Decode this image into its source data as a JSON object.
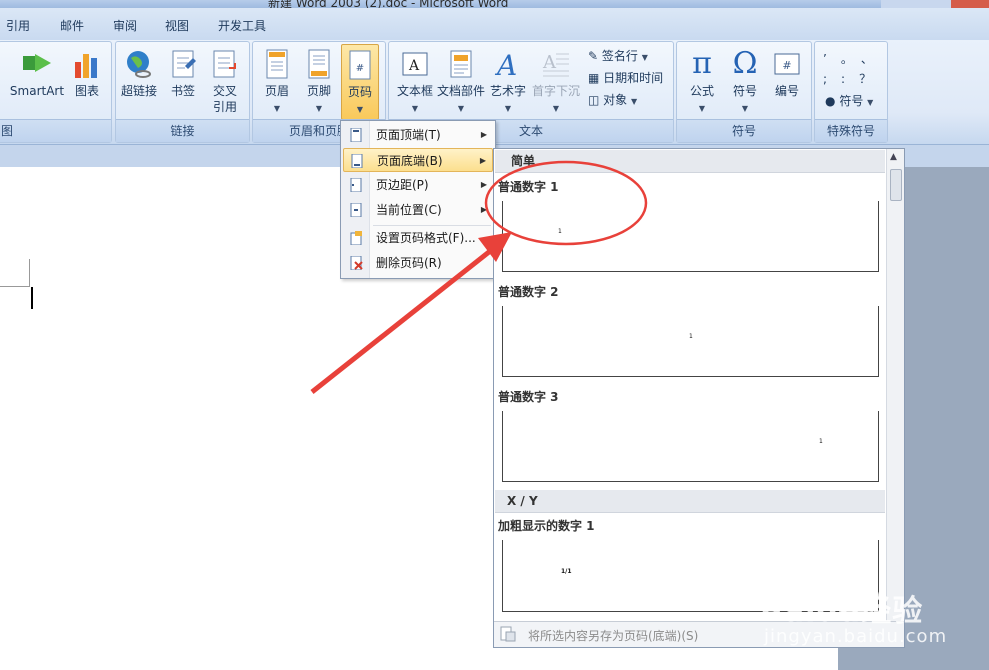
{
  "window": {
    "title_fragment": "新建 Word 2003 (2).doc - Microsoft Word"
  },
  "tabs": [
    "引用",
    "邮件",
    "审阅",
    "视图",
    "开发工具"
  ],
  "ribbon": {
    "illustrations": {
      "smartart": "SmartArt",
      "chart": "图表",
      "group_label": "图"
    },
    "links": {
      "hyperlink": "超链接",
      "bookmark": "书签",
      "crossref_line1": "交叉",
      "crossref_line2": "引用",
      "group_label": "链接"
    },
    "header_footer": {
      "header": "页眉",
      "footer": "页脚",
      "page_number": "页码",
      "group_label": "页眉和页脚"
    },
    "text": {
      "textbox": "文本框",
      "quickparts": "文档部件",
      "wordart": "艺术字",
      "dropcap": "首字下沉",
      "signature": "签名行",
      "datetime": "日期和时间",
      "object": "对象",
      "group_label": "文本"
    },
    "symbols": {
      "equation": "公式",
      "symbol": "符号",
      "number": "编号",
      "group_label": "符号"
    },
    "special": {
      "symbol": "符号",
      "group_label": "特殊符号",
      "chars": [
        "’",
        "。",
        "、",
        ";",
        ":",
        "？"
      ]
    }
  },
  "menu": {
    "items": [
      {
        "label": "页面顶端(T)",
        "has_sub": true
      },
      {
        "label": "页面底端(B)",
        "has_sub": true
      },
      {
        "label": "页边距(P)",
        "has_sub": true
      },
      {
        "label": "当前位置(C)",
        "has_sub": true
      },
      {
        "label": "设置页码格式(F)...",
        "has_sub": false
      },
      {
        "label": "删除页码(R)",
        "has_sub": false
      }
    ]
  },
  "gallery": {
    "section1": "简单",
    "items": [
      {
        "label": "普通数字 1",
        "num": "1"
      },
      {
        "label": "普通数字 2",
        "num": "1"
      },
      {
        "label": "普通数字 3",
        "num": "1"
      }
    ],
    "section2": "X / Y",
    "bold_item": {
      "label": "加粗显示的数字 1",
      "num": "1/1"
    },
    "footer": "将所选内容另存为页码(底端)(S)"
  },
  "watermark": {
    "brand": "Baidu经验",
    "url": "jingyan.baidu.com"
  },
  "colors": {
    "annotation": "#e8413a",
    "highlight": "#fcdf8e"
  }
}
